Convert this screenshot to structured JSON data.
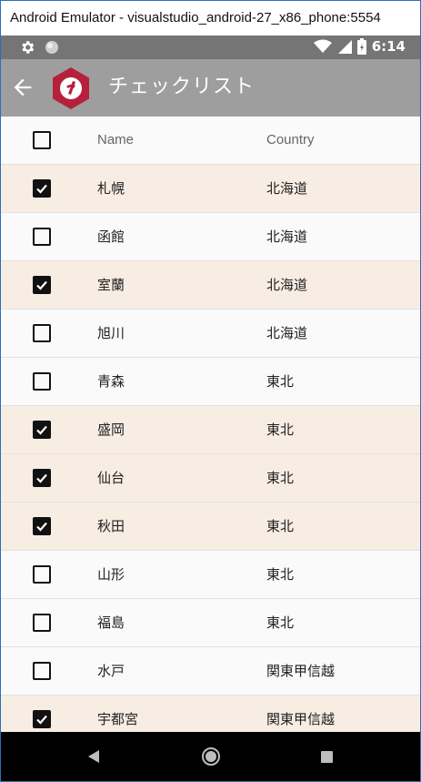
{
  "window": {
    "title": "Android Emulator - visualstudio_android-27_x86_phone:5554"
  },
  "status_bar": {
    "time": "6:14",
    "icons": [
      "gear-icon",
      "circle-icon",
      "wifi-icon",
      "signal-icon",
      "battery-icon"
    ]
  },
  "app_bar": {
    "title": "チェックリスト",
    "icons": [
      "back-arrow-icon",
      "app-logo-icon"
    ]
  },
  "table": {
    "headers": {
      "name": "Name",
      "country": "Country"
    },
    "rows": [
      {
        "name": "札幌",
        "country": "北海道",
        "checked": true
      },
      {
        "name": "函館",
        "country": "北海道",
        "checked": false
      },
      {
        "name": "室蘭",
        "country": "北海道",
        "checked": true
      },
      {
        "name": "旭川",
        "country": "北海道",
        "checked": false
      },
      {
        "name": "青森",
        "country": "東北",
        "checked": false
      },
      {
        "name": "盛岡",
        "country": "東北",
        "checked": true
      },
      {
        "name": "仙台",
        "country": "東北",
        "checked": true
      },
      {
        "name": "秋田",
        "country": "東北",
        "checked": true
      },
      {
        "name": "山形",
        "country": "東北",
        "checked": false
      },
      {
        "name": "福島",
        "country": "東北",
        "checked": false
      },
      {
        "name": "水戸",
        "country": "関東甲信越",
        "checked": false
      },
      {
        "name": "宇都宮",
        "country": "関東甲信越",
        "checked": true
      }
    ]
  },
  "nav_bar": {
    "icons": [
      "nav-back-icon",
      "nav-home-icon",
      "nav-recent-icon"
    ]
  },
  "colors": {
    "checked_row": "#f8ede3",
    "unchecked_row": "#fafafa",
    "app_bar": "#9e9e9e",
    "status_bar": "#757575",
    "logo_red": "#b5213a"
  }
}
